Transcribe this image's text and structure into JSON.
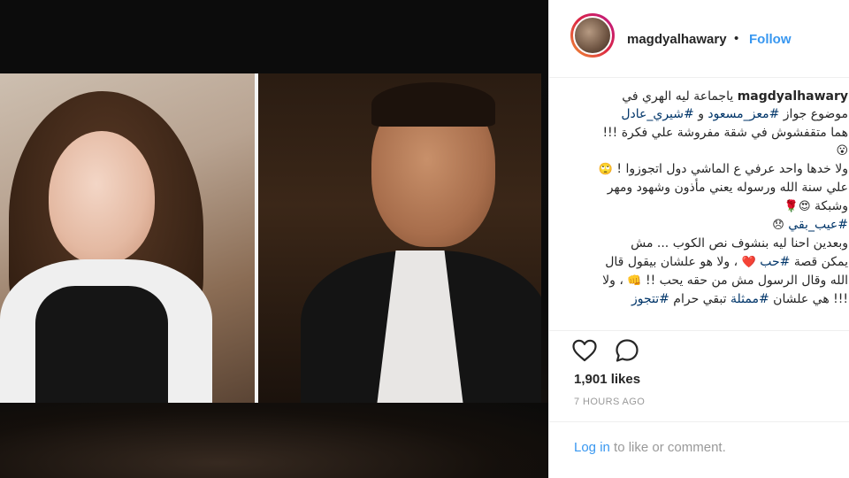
{
  "post": {
    "username": "magdyalhawary",
    "follow_label": "Follow",
    "separator": "•",
    "caption": {
      "line1_text": "ياجماعة ليه الهري في",
      "line2_prefix": "موضوع جواز",
      "line2_tag1": "#معز_مسعود",
      "line2_and": "و",
      "line2_tag2": "#شيري_عادل",
      "line3": "هما متقفشوش في شقة مفروشة علي فكرة !!!",
      "line4_emoji": "😮",
      "line5": "ولا خدها واحد عرفي ع الماشي دول اتجوزوا !",
      "line5_emoji": "🙄",
      "line6": "علي سنة الله ورسوله يعني مأذون وشهود ومهر",
      "line7": "وشبكة",
      "line7_emoji": "😍🌹",
      "line8_tag": "#عيب_بقي",
      "line8_emoji": "😞",
      "line9": "وبعدين احنا ليه بنشوف نص الكوب ... مش",
      "line10_prefix": "يمكن قصة",
      "line10_tag": "#حب",
      "line10_emoji": "❤️",
      "line10_suffix": "، ولا هو علشان بيقول قال",
      "line11": "الله وقال الرسول مش من حقه يحب !!",
      "line11_emoji": "👊",
      "line11_suffix": "، ولا",
      "line12_prefix": "!!! هي علشان",
      "line12_tag1": "#ممثلة",
      "line12_mid": "تبقي حرام",
      "line12_tag2": "#تتجوز"
    },
    "likes": "1,901 likes",
    "time": "7 HOURS AGO",
    "footer": {
      "login_link": "Log in",
      "login_rest": " to like or comment."
    }
  },
  "colors": {
    "accent": "#3897f0",
    "hashtag": "#003569",
    "text": "#262626",
    "muted": "#999999"
  },
  "icons": {
    "like": "heart-icon",
    "comment": "comment-icon"
  }
}
